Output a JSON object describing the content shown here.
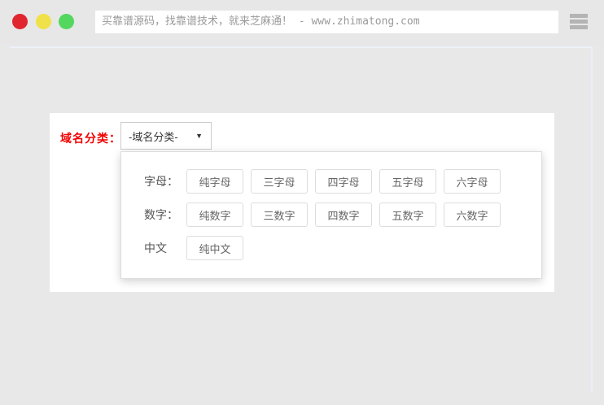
{
  "colors": {
    "red_light": "#e0252f",
    "yellow_light": "#f0e14a",
    "green_light": "#53d75e",
    "accent_red": "#f20000",
    "page_background": "#e8e8e8"
  },
  "browser_bar": {
    "address_text": "买靠谱源码，找靠谱技术，就来芝麻通！ - www.zhimatong.com",
    "window_lights": [
      "close",
      "minimize",
      "zoom"
    ]
  },
  "domain_filter": {
    "label": "域名分类：",
    "select_value": "-域名分类-",
    "select_arrow": "▼",
    "dropdown_rows": [
      {
        "label": "字母：",
        "options": [
          "纯字母",
          "三字母",
          "四字母",
          "五字母",
          "六字母"
        ]
      },
      {
        "label": "数字：",
        "options": [
          "纯数字",
          "三数字",
          "四数字",
          "五数字",
          "六数字"
        ]
      },
      {
        "label": "中文",
        "options": [
          "纯中文"
        ]
      }
    ]
  }
}
